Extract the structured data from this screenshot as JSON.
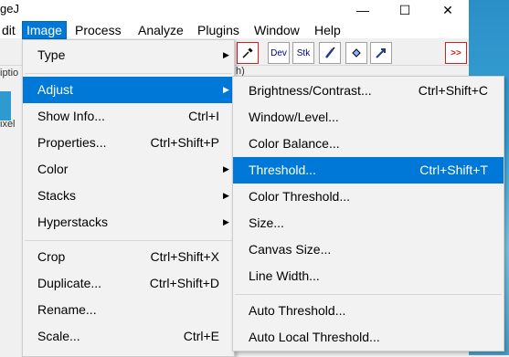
{
  "window": {
    "title_fragment": "geJ",
    "minimize": "—",
    "maximize": "☐",
    "close": "✕"
  },
  "menubar": [
    "dit",
    "Image",
    "Process",
    "Analyze",
    "Plugins",
    "Window",
    "Help"
  ],
  "toolbar": {
    "dev_label": "Dev",
    "stk_label": "Stk",
    "more_label": ">>"
  },
  "background_text": {
    "left_fragment_1": "iptio",
    "left_fragment_2": "ixel",
    "paren": "h)"
  },
  "image_menu": {
    "items": [
      {
        "label": "Type",
        "shortcut": "",
        "submenu": true
      },
      {
        "label": "Adjust",
        "shortcut": "",
        "submenu": true,
        "highlighted": true
      },
      {
        "label": "Show Info...",
        "shortcut": "Ctrl+I",
        "submenu": false
      },
      {
        "label": "Properties...",
        "shortcut": "Ctrl+Shift+P",
        "submenu": false
      },
      {
        "label": "Color",
        "shortcut": "",
        "submenu": true
      },
      {
        "label": "Stacks",
        "shortcut": "",
        "submenu": true
      },
      {
        "label": "Hyperstacks",
        "shortcut": "",
        "submenu": true
      },
      {
        "label": "Crop",
        "shortcut": "Ctrl+Shift+X",
        "submenu": false
      },
      {
        "label": "Duplicate...",
        "shortcut": "Ctrl+Shift+D",
        "submenu": false
      },
      {
        "label": "Rename...",
        "shortcut": "",
        "submenu": false
      },
      {
        "label": "Scale...",
        "shortcut": "Ctrl+E",
        "submenu": false
      }
    ]
  },
  "adjust_menu": {
    "items": [
      {
        "label": "Brightness/Contrast...",
        "shortcut": "Ctrl+Shift+C"
      },
      {
        "label": "Window/Level...",
        "shortcut": ""
      },
      {
        "label": "Color Balance...",
        "shortcut": ""
      },
      {
        "label": "Threshold...",
        "shortcut": "Ctrl+Shift+T",
        "highlighted": true
      },
      {
        "label": "Color Threshold...",
        "shortcut": ""
      },
      {
        "label": "Size...",
        "shortcut": ""
      },
      {
        "label": "Canvas Size...",
        "shortcut": ""
      },
      {
        "label": "Line Width...",
        "shortcut": ""
      },
      {
        "label": "Auto Threshold...",
        "shortcut": ""
      },
      {
        "label": "Auto Local Threshold...",
        "shortcut": ""
      }
    ]
  },
  "colors": {
    "highlight": "#0078d7",
    "menu_bg": "#f2f2f2",
    "more_red": "#d02020"
  }
}
